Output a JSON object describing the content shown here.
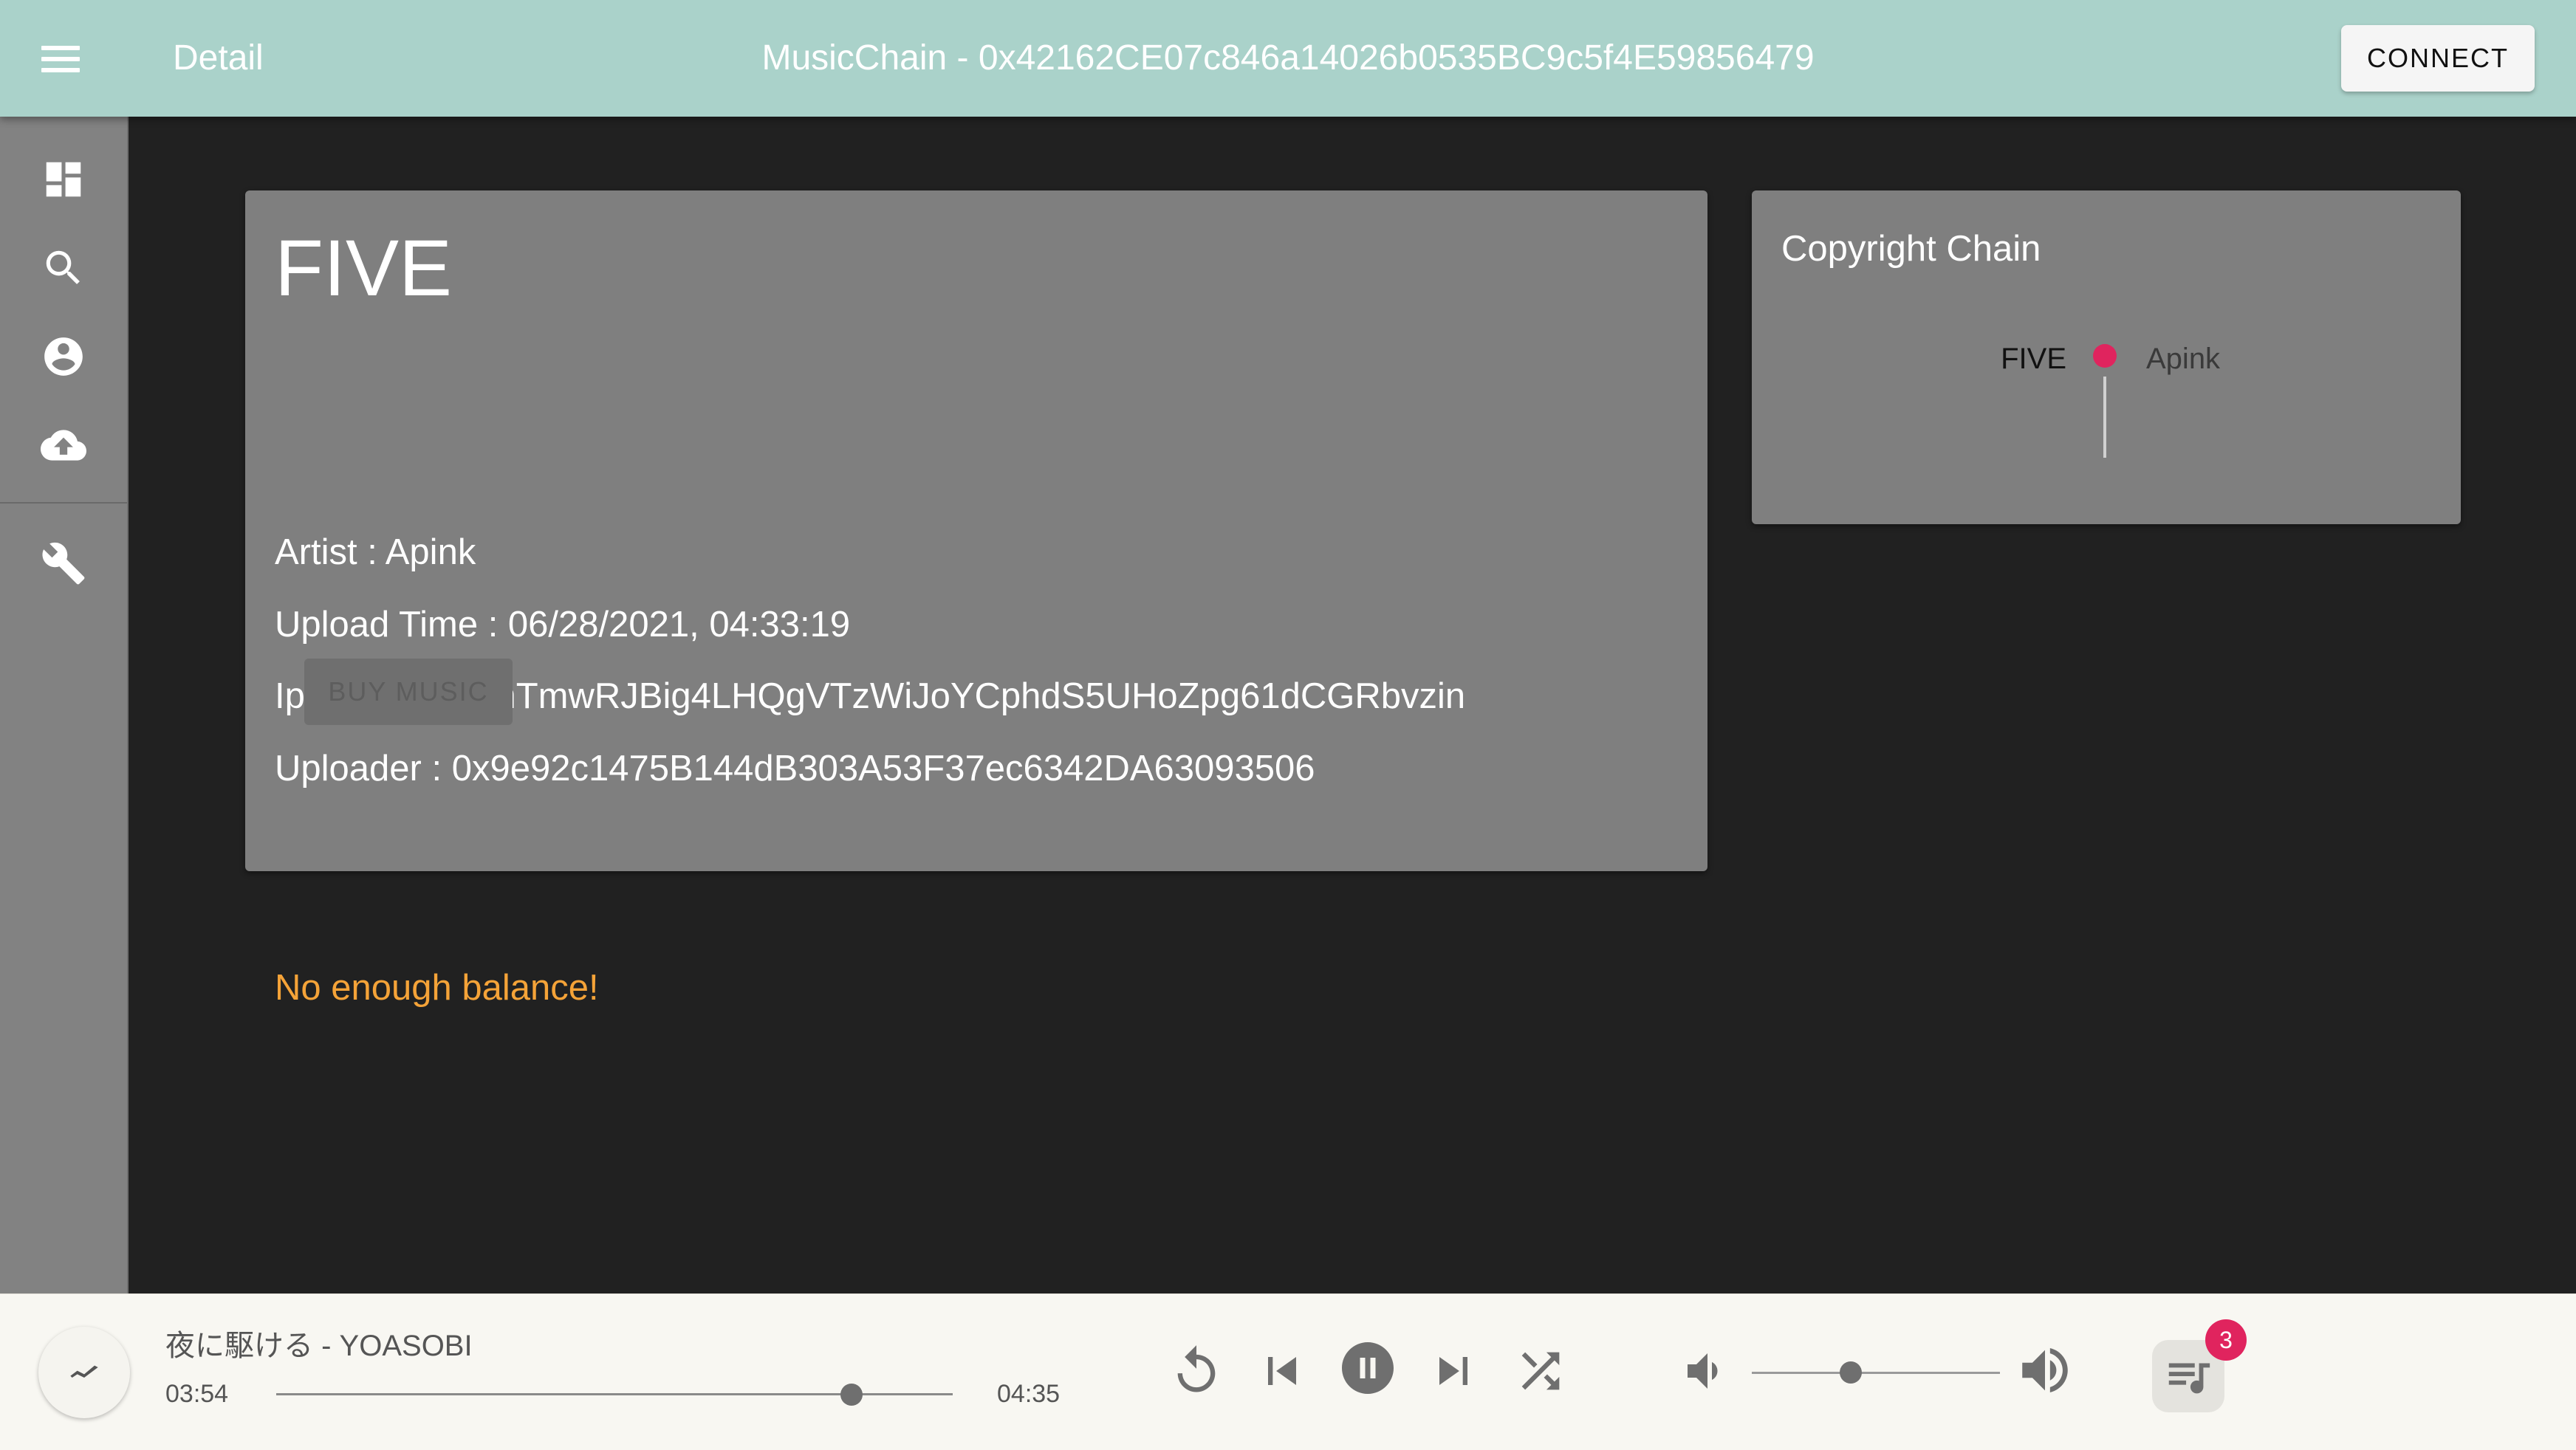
{
  "header": {
    "page_title": "Detail",
    "app_title": "MusicChain - 0x42162CE07c846a14026b0535BC9c5f4E59856479",
    "connect_label": "CONNECT",
    "bar_color": "#aad2ca"
  },
  "sidebar": {
    "items": [
      {
        "icon": "dashboard-icon",
        "label": "dashboard"
      },
      {
        "icon": "search-icon",
        "label": "search"
      },
      {
        "icon": "account-circle-icon",
        "label": "account"
      },
      {
        "icon": "cloud-upload-icon",
        "label": "upload"
      },
      {
        "icon": "wrench-icon",
        "label": "settings"
      }
    ]
  },
  "detail": {
    "title": "FIVE",
    "artist": "Artist : Apink",
    "upload_time": "Upload Time : 06/28/2021, 04:33:19",
    "ipfs_hash": "Ipfs Hash : QmTmwRJBig4LHQgVTzWiJoYCphdS5UHoZpg61dCGRbvzin",
    "uploader": "Uploader : 0x9e92c1475B144dB303A53F37ec6342DA63093506",
    "buy_label": "BUY MUSIC",
    "warning": "No enough balance!",
    "warning_color": "#f5a338"
  },
  "copyright_chain": {
    "title": "Copyright Chain",
    "entries": [
      {
        "song": "FIVE",
        "artist": "Apink"
      }
    ],
    "dot_color": "#e0245e"
  },
  "player": {
    "track": "夜に駆ける - YOASOBI",
    "current_time": "03:54",
    "total_time": "04:35",
    "progress": 0.85,
    "volume": 0.4,
    "queue_count": "3",
    "controls": [
      "replay-icon",
      "skip-previous-icon",
      "pause-icon",
      "skip-next-icon",
      "shuffle-icon"
    ]
  }
}
